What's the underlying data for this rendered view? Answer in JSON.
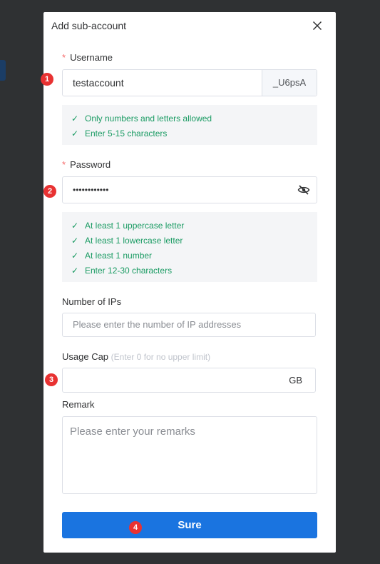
{
  "dialog": {
    "title": "Add sub-account",
    "close_icon": "close-icon"
  },
  "username": {
    "label": "Username",
    "required_mark": "*",
    "value": "testaccount",
    "suffix": "_U6psA",
    "rules": [
      "Only numbers and letters allowed",
      "Enter 5-15 characters"
    ]
  },
  "password": {
    "label": "Password",
    "required_mark": "*",
    "value": "••••••••••••",
    "toggle_icon": "eye-off-icon",
    "rules": [
      "At least 1 uppercase letter",
      "At least 1 lowercase letter",
      "At least 1 number",
      "Enter 12-30 characters"
    ]
  },
  "ips": {
    "label": "Number of IPs",
    "placeholder": "Please enter the number of IP addresses"
  },
  "usage_cap": {
    "label": "Usage Cap",
    "hint": "(Enter 0 for no upper limit)",
    "value": "",
    "unit": "GB"
  },
  "remark": {
    "label": "Remark",
    "placeholder": "Please enter your remarks"
  },
  "submit": {
    "label": "Sure"
  },
  "badges": [
    "1",
    "2",
    "3",
    "4"
  ],
  "colors": {
    "accent": "#1a74e0",
    "success": "#1a9b63",
    "required": "#f56c6c",
    "badge": "#e83232",
    "overlay": "#2f3133"
  }
}
